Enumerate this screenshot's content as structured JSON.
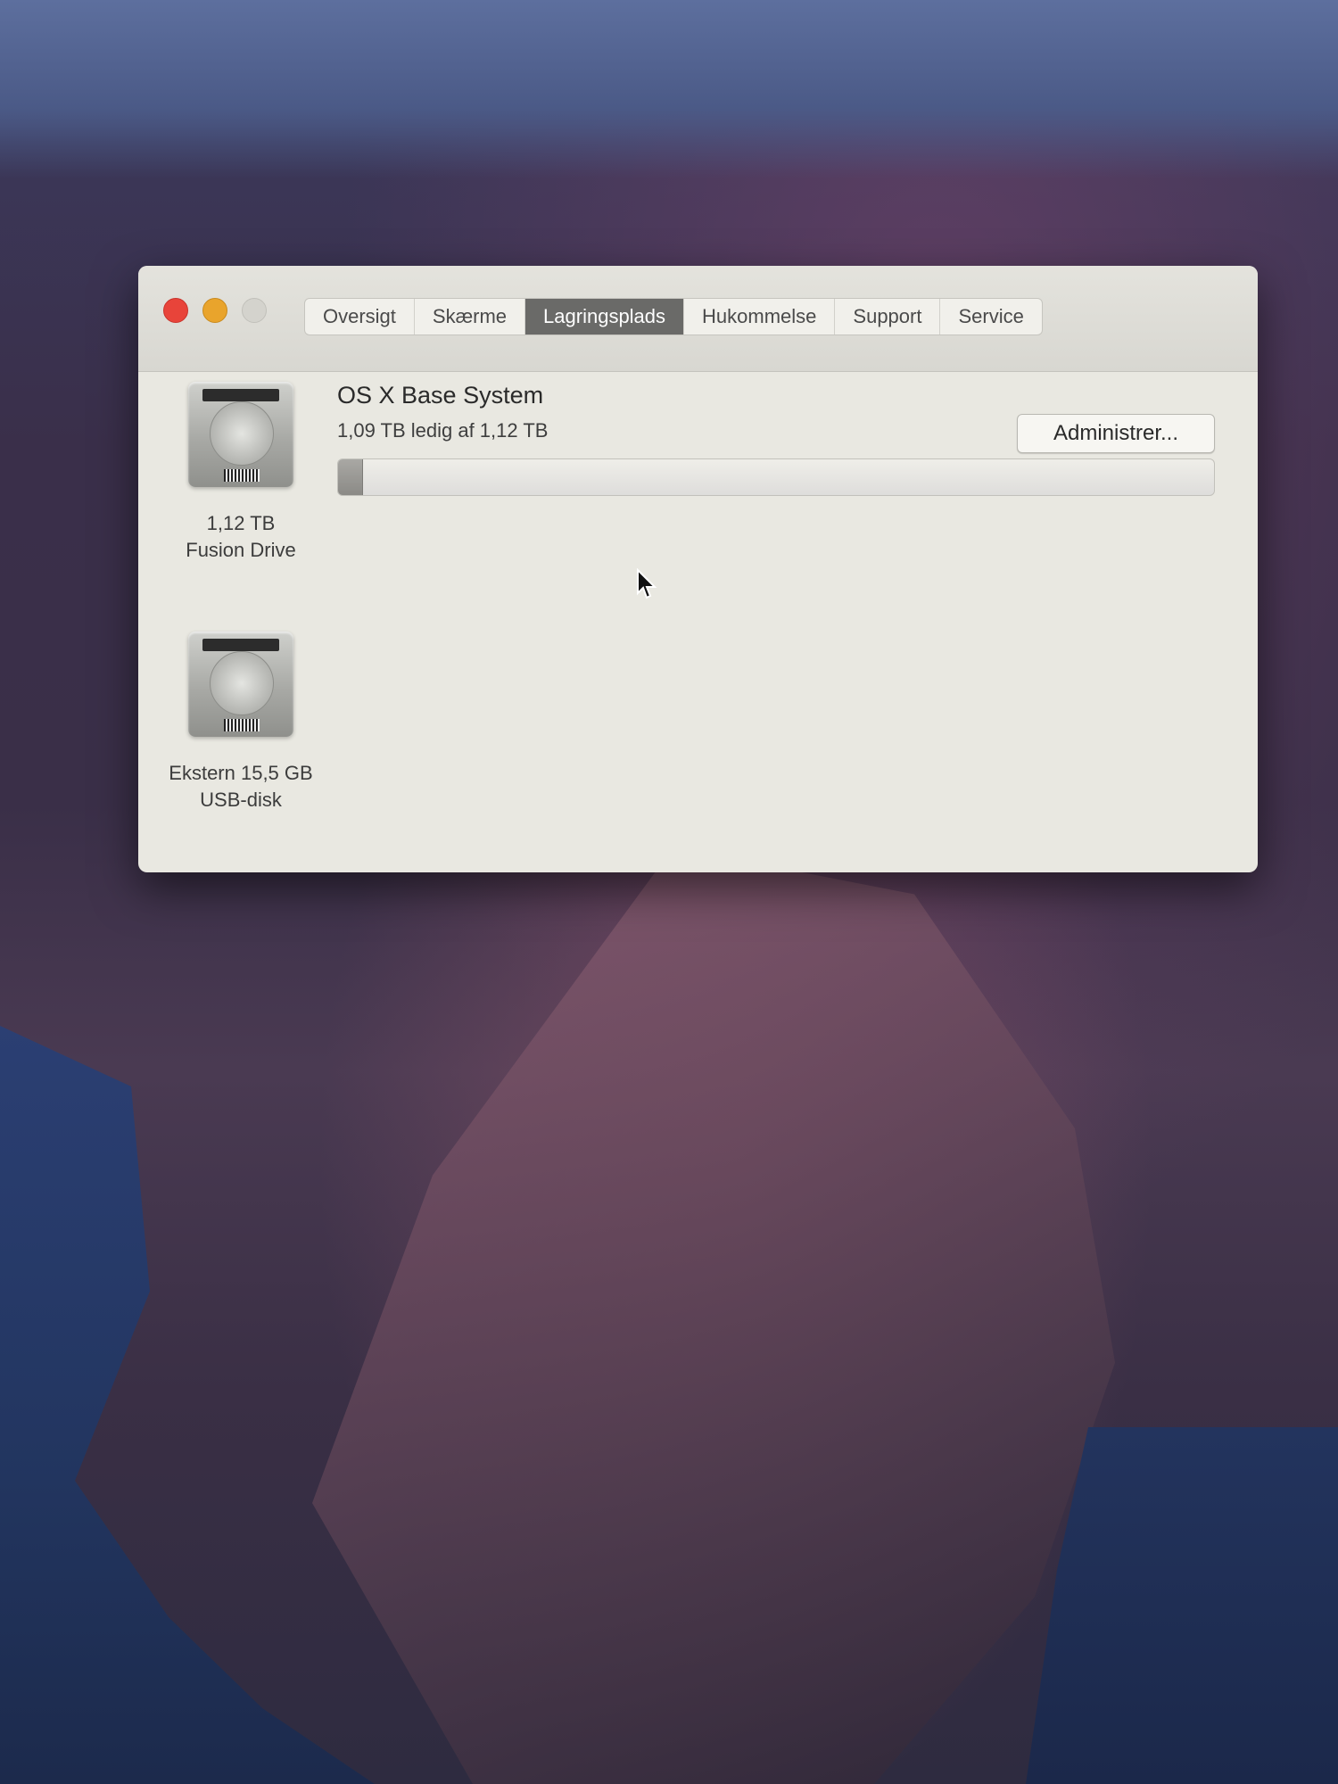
{
  "window": {
    "tabs": [
      {
        "label": "Oversigt",
        "active": false
      },
      {
        "label": "Skærme",
        "active": false
      },
      {
        "label": "Lagringsplads",
        "active": true
      },
      {
        "label": "Hukommelse",
        "active": false
      },
      {
        "label": "Support",
        "active": false
      },
      {
        "label": "Service",
        "active": false
      }
    ]
  },
  "disks": [
    {
      "line1": "1,12 TB",
      "line2": "Fusion Drive",
      "icon": "hard-drive-icon"
    },
    {
      "line1": "Ekstern 15,5 GB",
      "line2": "USB-disk",
      "icon": "hard-drive-icon"
    }
  ],
  "volume": {
    "name": "OS X Base System",
    "info": "1,09 TB ledig af 1,12 TB",
    "used_fraction": 0.027
  },
  "manage_button": {
    "label": "Administrer..."
  },
  "colors": {
    "close": "#e8443a",
    "minimize": "#e9a42c",
    "active_tab": "#6a6a68"
  }
}
